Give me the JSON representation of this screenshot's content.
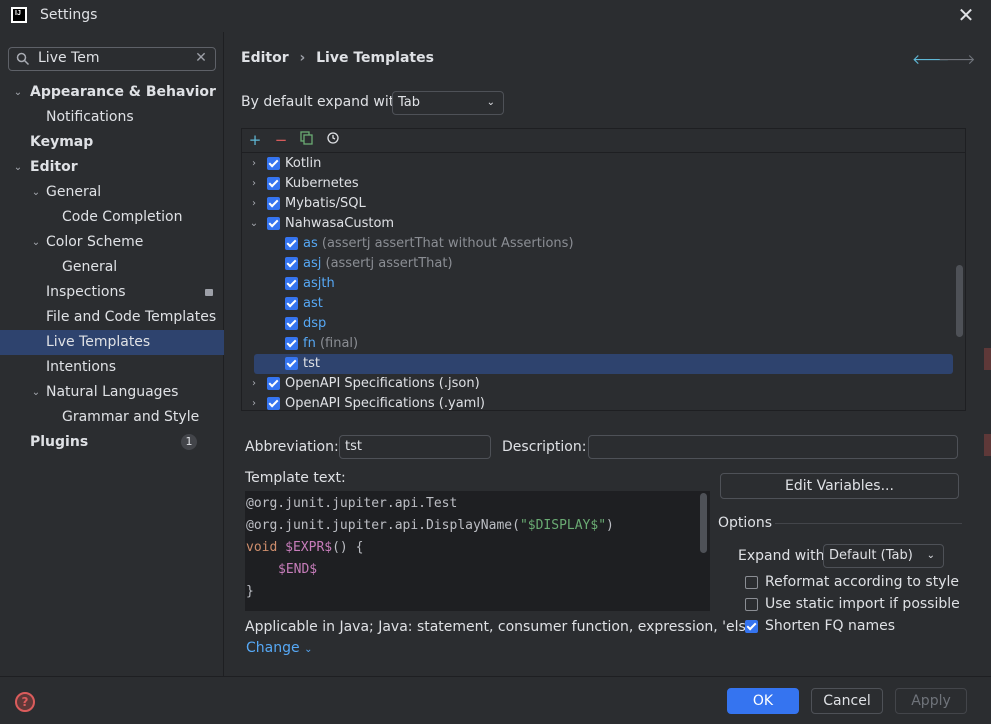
{
  "window": {
    "title": "Settings",
    "logo_text": "IJ"
  },
  "search": {
    "value": "Live Tem"
  },
  "sidebar": {
    "items": [
      {
        "label": "Appearance & Behavior",
        "bold": true
      },
      {
        "label": "Notifications"
      },
      {
        "label": "Keymap",
        "bold": true
      },
      {
        "label": "Editor",
        "bold": true
      },
      {
        "label": "General"
      },
      {
        "label": "Code Completion"
      },
      {
        "label": "Color Scheme"
      },
      {
        "label": "General"
      },
      {
        "label": "Inspections"
      },
      {
        "label": "File and Code Templates"
      },
      {
        "label": "Live Templates",
        "selected": true
      },
      {
        "label": "Intentions"
      },
      {
        "label": "Natural Languages"
      },
      {
        "label": "Grammar and Style"
      },
      {
        "label": "Plugins",
        "bold": true,
        "badge": "1"
      }
    ]
  },
  "breadcrumb": {
    "parent": "Editor",
    "separator": "›",
    "current": "Live Templates"
  },
  "expand": {
    "label": "By default expand with",
    "value": "Tab"
  },
  "templates": {
    "groups": [
      {
        "name": "Kotlin",
        "expanded": false,
        "checked": true
      },
      {
        "name": "Kubernetes",
        "expanded": false,
        "checked": true
      },
      {
        "name": "Mybatis/SQL",
        "expanded": false,
        "checked": true
      },
      {
        "name": "NahwasaCustom",
        "expanded": true,
        "checked": true
      },
      {
        "name": "OpenAPI Specifications (.json)",
        "expanded": false,
        "checked": true
      },
      {
        "name": "OpenAPI Specifications (.yaml)",
        "expanded": false,
        "checked": true
      }
    ],
    "items": [
      {
        "abbr": "as",
        "desc": "(assertj assertThat without Assertions)"
      },
      {
        "abbr": "asj",
        "desc": "(assertj assertThat)"
      },
      {
        "abbr": "asjth",
        "desc": ""
      },
      {
        "abbr": "ast",
        "desc": ""
      },
      {
        "abbr": "dsp",
        "desc": ""
      },
      {
        "abbr": "fn",
        "desc": "(final)"
      },
      {
        "abbr": "tst",
        "desc": "",
        "selected": true
      }
    ]
  },
  "form": {
    "abbreviation_label": "Abbreviation:",
    "abbreviation_value": "tst",
    "description_label": "Description:",
    "description_value": "",
    "template_text_label": "Template text:",
    "code": {
      "line1": "@org.junit.jupiter.api.Test",
      "line2_a": "@org.junit.jupiter.api.DisplayName(",
      "line2_str": "\"$DISPLAY$\"",
      "line2_b": ")",
      "line3_kw": "void",
      "line3_var": "$EXPR$",
      "line3_b": "() {",
      "line4_var": "$END$",
      "line5": "}"
    },
    "applicable": "Applicable in Java; Java: statement, consumer function, expression, 'els...",
    "change_link": "Change"
  },
  "options": {
    "edit_variables": "Edit Variables...",
    "title": "Options",
    "expand_with_label": "Expand with",
    "expand_with_value": "Default (Tab)",
    "reformat": {
      "label": "Reformat according to style",
      "checked": false
    },
    "static_import": {
      "label": "Use static import if possible",
      "checked": false
    },
    "shorten_fq": {
      "label": "Shorten FQ names",
      "checked": true
    }
  },
  "footer": {
    "ok": "OK",
    "cancel": "Cancel",
    "apply": "Apply",
    "help": "?"
  },
  "colors": {
    "accent": "#3574f0",
    "selection": "#2e436e",
    "link": "#56a8f5"
  }
}
